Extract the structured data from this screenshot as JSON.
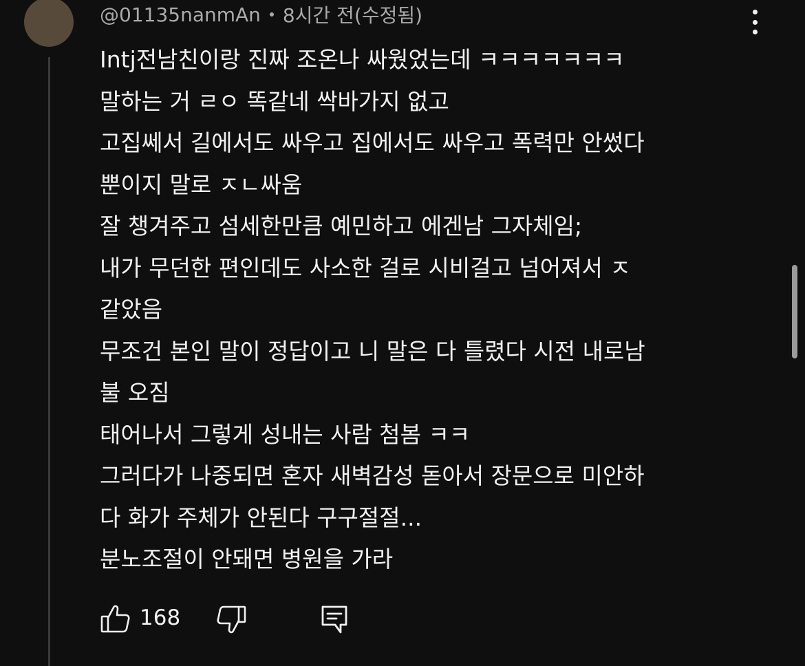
{
  "comment": {
    "author": "@01135nanmAn",
    "time": "8시간 전(수정됨)",
    "lines": [
      "Intj전남친이랑 진짜 조온나 싸웠었는데 ㅋㅋㅋㅋㅋㅋㅋ",
      "말하는 거 ㄹㅇ 똑같네 싹바가지 없고",
      "고집쎄서 길에서도 싸우고 집에서도 싸우고 폭력만 안썼다",
      "뿐이지 말로 ㅈㄴ싸움",
      "잘 챙겨주고 섬세한만큼 예민하고 에겐남 그자체임;",
      "내가 무던한 편인데도 사소한 걸로 시비걸고 넘어져서 ㅈ",
      "같았음",
      "무조건 본인 말이 정답이고 니 말은 다 틀렸다 시전 내로남",
      "불 오짐",
      "태어나서 그렇게 성내는 사람 첨봄 ㅋㅋ",
      "그러다가 나중되면 혼자 새벽감성 돋아서 장문으로 미안하",
      "다 화가 주체가 안된다 구구절절...",
      "분노조절이 안돼면 병원을 가라"
    ],
    "like_count": "168"
  },
  "icons": {
    "menu": "more-vertical-icon",
    "like": "thumbs-up-icon",
    "dislike": "thumbs-down-icon",
    "reply": "comment-reply-icon"
  },
  "colors": {
    "background": "#0f0f0f",
    "text": "#f1f1f1",
    "secondary_text": "#aaaaaa",
    "avatar": "#574a3a",
    "thread_line": "#3a3a3a"
  }
}
